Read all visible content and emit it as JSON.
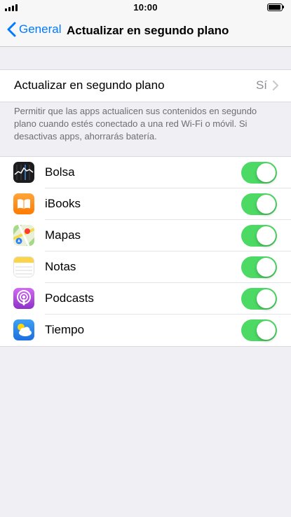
{
  "status_bar": {
    "time": "10:00"
  },
  "nav": {
    "back_label": "General",
    "title": "Actualizar en segundo plano"
  },
  "main_setting": {
    "label": "Actualizar en segundo plano",
    "value": "Sí"
  },
  "footer_note": "Permitir que las apps actualicen sus contenidos en segundo plano cuando estés conectado a una red Wi-Fi o móvil. Si desactivas apps, ahorrarás batería.",
  "apps": [
    {
      "name": "Bolsa",
      "icon": "stocks-icon",
      "enabled": true
    },
    {
      "name": "iBooks",
      "icon": "ibooks-icon",
      "enabled": true
    },
    {
      "name": "Mapas",
      "icon": "maps-icon",
      "enabled": true
    },
    {
      "name": "Notas",
      "icon": "notes-icon",
      "enabled": true
    },
    {
      "name": "Podcasts",
      "icon": "podcasts-icon",
      "enabled": true
    },
    {
      "name": "Tiempo",
      "icon": "weather-icon",
      "enabled": true
    }
  ],
  "colors": {
    "accent": "#007aff",
    "toggle_on": "#4cd964",
    "background": "#efeff4"
  }
}
